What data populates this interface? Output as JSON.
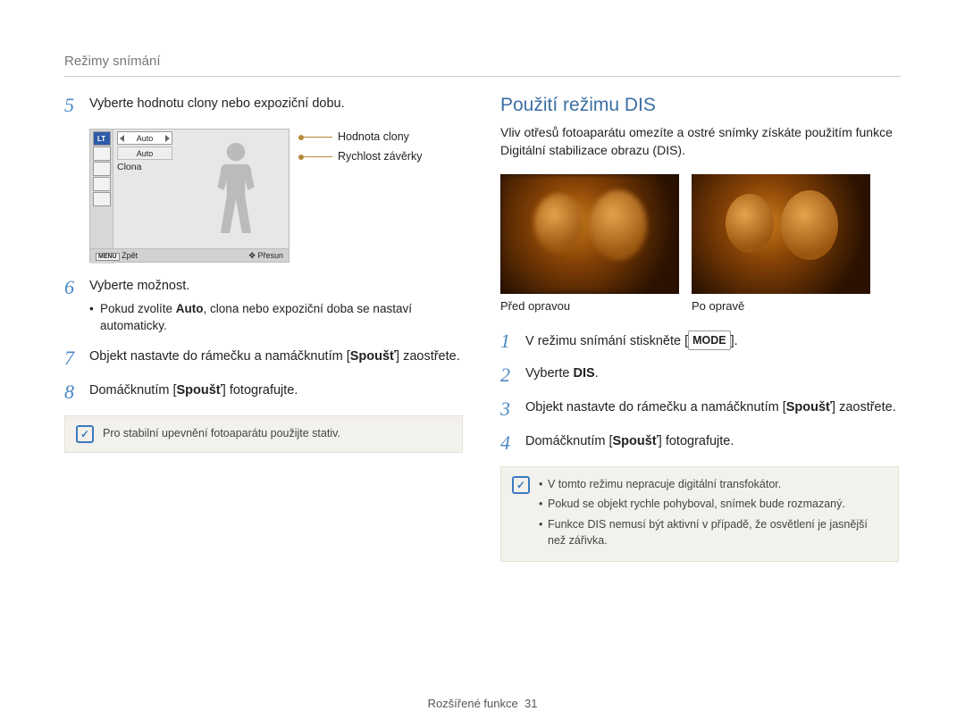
{
  "breadcrumb": "Režimy snímání",
  "left": {
    "step5": {
      "num": "5",
      "text": "Vyberte hodnotu clony nebo expoziční dobu."
    },
    "lcd": {
      "top_left_badge": "LT",
      "row1": "Auto",
      "row2": "Auto",
      "row3": "Clona",
      "bottom_menu": "MENU",
      "bottom_left": "Zpět",
      "bottom_right": "Přesun"
    },
    "legend1": "Hodnota clony",
    "legend2": "Rychlost závěrky",
    "step6": {
      "num": "6",
      "text": "Vyberte možnost.",
      "bullet_pre": "Pokud zvolíte ",
      "bullet_bold": "Auto",
      "bullet_post": ", clona nebo expoziční doba se nastaví automaticky."
    },
    "step7": {
      "num": "7",
      "pre": "Objekt nastavte do rámečku a namáčknutím [",
      "bold": "Spoušť",
      "post": "] zaostřete."
    },
    "step8": {
      "num": "8",
      "pre": "Domáčknutím [",
      "bold": "Spoušť",
      "post": "] fotografujte."
    },
    "note": "Pro stabilní upevnění fotoaparátu použijte stativ."
  },
  "right": {
    "title": "Použití režimu DIS",
    "intro": "Vliv otřesů fotoaparátu omezíte a ostré snímky získáte použitím funkce Digitální stabilizace obrazu (DIS).",
    "caption_before": "Před opravou",
    "caption_after": "Po opravě",
    "step1": {
      "num": "1",
      "pre": "V režimu snímání stiskněte [",
      "mode": "MODE",
      "post": "]."
    },
    "step2": {
      "num": "2",
      "pre": "Vyberte ",
      "bold": "DIS",
      "post": "."
    },
    "step3": {
      "num": "3",
      "pre": "Objekt nastavte do rámečku a namáčknutím [",
      "bold": "Spoušť",
      "post": "] zaostřete."
    },
    "step4": {
      "num": "4",
      "pre": "Domáčknutím [",
      "bold": "Spoušť",
      "post": "] fotografujte."
    },
    "notes": [
      "V tomto režimu nepracuje digitální transfokátor.",
      "Pokud se objekt rychle pohyboval, snímek bude rozmazaný.",
      "Funkce DIS nemusí být aktivní v případě, že osvětlení je jasnější než zářivka."
    ]
  },
  "footer": {
    "label": "Rozšířené funkce",
    "page": "31"
  }
}
